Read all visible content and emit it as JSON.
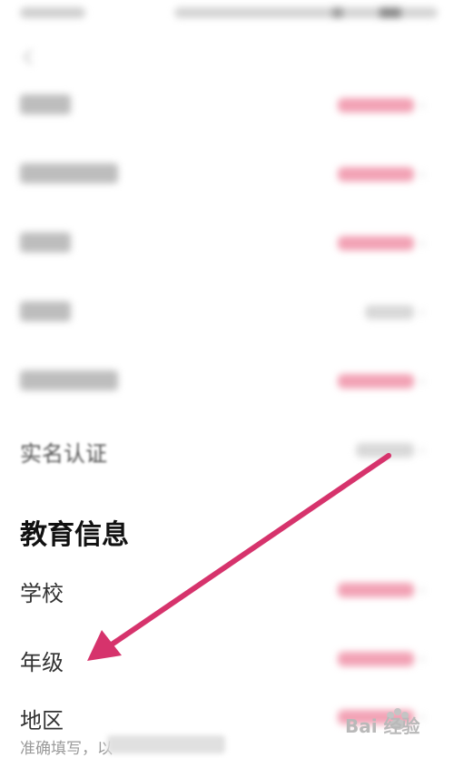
{
  "settings_list": {
    "items": [
      {
        "key": "avatar",
        "label": "",
        "value_style": "pink"
      },
      {
        "key": "nickname",
        "label": "",
        "value_style": "pink"
      },
      {
        "key": "gender",
        "label": "",
        "value_style": "pink"
      },
      {
        "key": "birthday",
        "label": "",
        "value_style": "grey"
      },
      {
        "key": "bio",
        "label": "",
        "value_style": "pink"
      },
      {
        "key": "real_name",
        "label": "实名认证",
        "value_style": "grey"
      }
    ]
  },
  "education": {
    "title": "教育信息",
    "items": [
      {
        "key": "school",
        "label": "学校"
      },
      {
        "key": "grade",
        "label": "年级"
      },
      {
        "key": "region",
        "label": "地区"
      }
    ],
    "hint": "准确填写，以"
  },
  "colors": {
    "accent_pink": "#f2a1b4",
    "arrow": "#d6336c"
  },
  "watermark": {
    "text": "Bai 经验"
  }
}
